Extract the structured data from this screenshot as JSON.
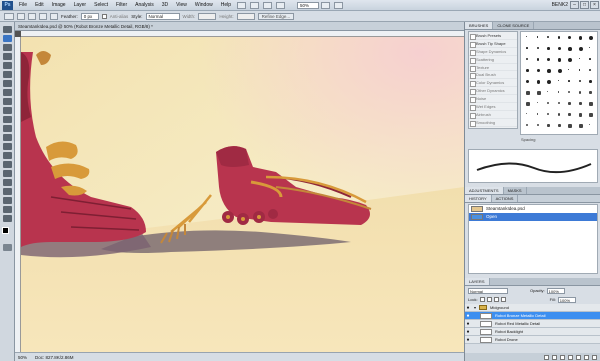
{
  "menubar": {
    "logo": "Ps",
    "items": [
      "File",
      "Edit",
      "Image",
      "Layer",
      "Select",
      "Filter",
      "Analysis",
      "3D",
      "View",
      "Window",
      "Help"
    ],
    "zoom": "50%",
    "workspace": "BENK2",
    "window_buttons": [
      "–",
      "□",
      "×"
    ]
  },
  "options": {
    "feather_label": "Feather:",
    "feather_value": "0 px",
    "antialias_label": "Anti-alias",
    "style_label": "Style:",
    "style_value": "Normal",
    "width_label": "Width:",
    "height_label": "Height:",
    "refine_label": "Refine Edge..."
  },
  "document": {
    "tab_title": "SteamtankIdea.psd @ 50% (Robot Bronze Metallic Detail, RGB/8) *",
    "status_zoom": "50%",
    "status_doc": "Doc: 827.8K/2.86M"
  },
  "brushes": {
    "tabs": [
      "BRUSHES",
      "CLONE SOURCE"
    ],
    "preset_label": "Brush Presets",
    "tip_label": "Brush Tip Shape",
    "options": [
      "Shape Dynamics",
      "Scattering",
      "Texture",
      "Dual Brush",
      "Color Dynamics",
      "Other Dynamics",
      "Noise",
      "Wet Edges",
      "Airbrush",
      "Smoothing",
      "Protect Texture"
    ],
    "spacing_label": "Spacing"
  },
  "history": {
    "tabs": [
      "ADJUSTMENTS",
      "MASKS"
    ],
    "subtabs": [
      "HISTORY",
      "ACTIONS"
    ],
    "items": [
      {
        "label": "SteamtankIdea.psd",
        "selected": false
      },
      {
        "label": "Open",
        "selected": true
      }
    ]
  },
  "layers": {
    "tabs": [
      "LAYERS"
    ],
    "blend_mode": "Normal",
    "opacity_label": "Opacity:",
    "opacity_value": "100%",
    "lock_label": "Lock:",
    "fill_label": "Fill:",
    "fill_value": "100%",
    "items": [
      {
        "name": "Midground",
        "type": "group",
        "selected": false
      },
      {
        "name": "Robot Bronze Metallic Detail",
        "type": "layer",
        "selected": true
      },
      {
        "name": "Robot Red Metallic Detail",
        "type": "layer",
        "selected": false
      },
      {
        "name": "Robot Backlight",
        "type": "layer",
        "selected": false
      },
      {
        "name": "Robot Drone",
        "type": "layer",
        "selected": false
      }
    ]
  },
  "colors": {
    "selection": "#3d8ff0",
    "robot_red": "#b8344e",
    "bronze": "#d89a3a",
    "sand": "#f4e6b8"
  }
}
